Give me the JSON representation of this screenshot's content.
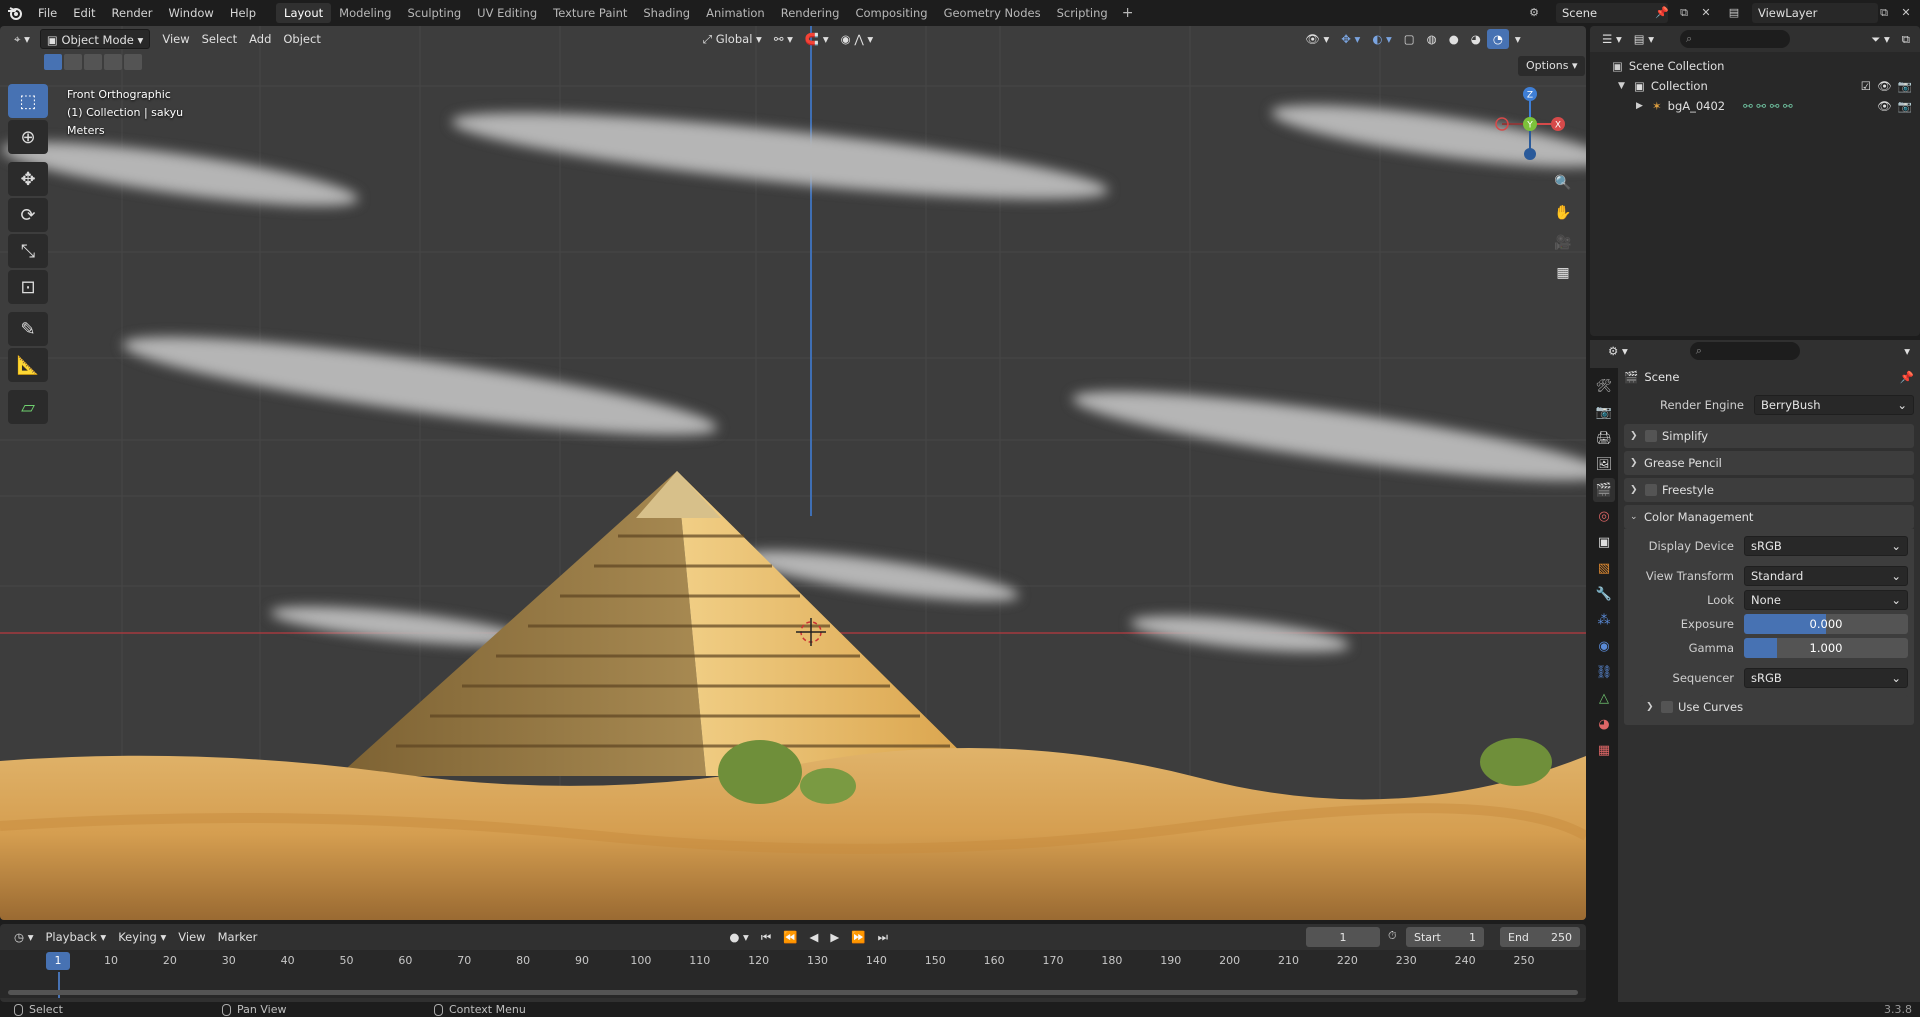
{
  "menu": {
    "file": "File",
    "edit": "Edit",
    "render": "Render",
    "window": "Window",
    "help": "Help"
  },
  "workspaces": [
    "Layout",
    "Modeling",
    "Sculpting",
    "UV Editing",
    "Texture Paint",
    "Shading",
    "Animation",
    "Rendering",
    "Compositing",
    "Geometry Nodes",
    "Scripting"
  ],
  "active_workspace": "Layout",
  "scene_name": "Scene",
  "view_layer": "ViewLayer",
  "viewport": {
    "mode": "Object Mode",
    "menus": [
      "View",
      "Select",
      "Add",
      "Object"
    ],
    "orientation": "Global",
    "options_label": "Options",
    "overlay_lines": [
      "Front Orthographic",
      "(1) Collection | sakyu",
      "Meters"
    ],
    "gizmo": {
      "z": "Z",
      "y": "Y",
      "x": "X"
    }
  },
  "outliner": {
    "root": "Scene Collection",
    "collection": "Collection",
    "object": "bgA_0402"
  },
  "properties": {
    "context": "Scene",
    "render_engine_label": "Render Engine",
    "render_engine": "BerryBush",
    "panels": {
      "simplify": "Simplify",
      "grease_pencil": "Grease Pencil",
      "freestyle": "Freestyle",
      "color_management": "Color Management"
    },
    "color_management": {
      "display_device_label": "Display Device",
      "display_device": "sRGB",
      "view_transform_label": "View Transform",
      "view_transform": "Standard",
      "look_label": "Look",
      "look": "None",
      "exposure_label": "Exposure",
      "exposure": "0.000",
      "gamma_label": "Gamma",
      "gamma": "1.000",
      "sequencer_label": "Sequencer",
      "sequencer": "sRGB",
      "use_curves": "Use Curves"
    }
  },
  "timeline": {
    "menus": [
      "Playback",
      "Keying",
      "View",
      "Marker"
    ],
    "current_frame": "1",
    "start_label": "Start",
    "start": "1",
    "end_label": "End",
    "end": "250",
    "ticks": [
      "1",
      "10",
      "20",
      "30",
      "40",
      "50",
      "60",
      "70",
      "80",
      "90",
      "100",
      "110",
      "120",
      "130",
      "140",
      "150",
      "160",
      "170",
      "180",
      "190",
      "200",
      "210",
      "220",
      "230",
      "240",
      "250"
    ]
  },
  "status": {
    "select": "Select",
    "pan_view": "Pan View",
    "context_menu": "Context Menu",
    "version": "3.3.8"
  },
  "colors": {
    "accent": "#4772b3",
    "sand": "#d9a35a",
    "pyramid": "#c9a060"
  }
}
